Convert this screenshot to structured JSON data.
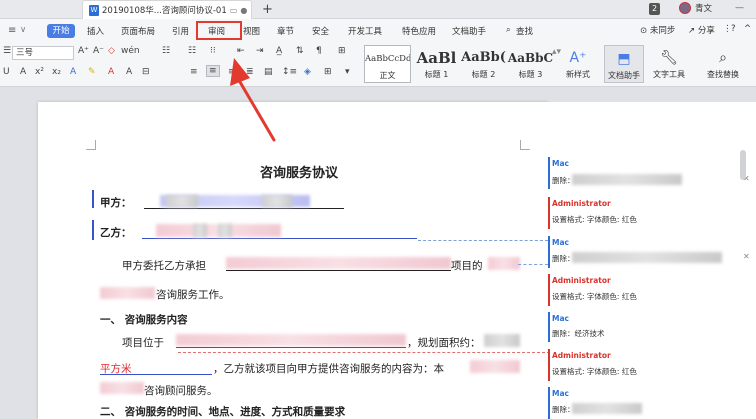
{
  "titlebar": {
    "doc_tab_title": "20190108华...咨询顾问协议-01",
    "new_tab": "+",
    "badge": "2",
    "user_name": "青文",
    "window_controls": "—"
  },
  "ribbon": {
    "menu_icon": "≡",
    "tabs": [
      "开始",
      "插入",
      "页面布局",
      "引用",
      "审阅",
      "视图",
      "章节",
      "安全",
      "开发工具",
      "特色应用",
      "文档助手",
      "查找"
    ],
    "right": {
      "unsynced": "未同步",
      "share": "分享",
      "more": "⋮",
      "help": "?",
      "collapse": "^"
    }
  },
  "toolbar": {
    "font_size": "三号",
    "styles": [
      {
        "preview": "AaBbCcDd",
        "label": "正文"
      },
      {
        "preview": "AaBl",
        "label": "标题 1"
      },
      {
        "preview": "AaBb(",
        "label": "标题 2"
      },
      {
        "preview": "AaBbC",
        "label": "标题 3"
      }
    ],
    "new_style": "新样式",
    "doc_assistant": "文档助手",
    "text_tools": "文字工具",
    "find_replace": "查找替换"
  },
  "document": {
    "title": "咨询服务协议",
    "party_a": "甲方：",
    "party_b": "乙方：",
    "para1_a": "甲方委托乙方承担",
    "para1_b": "项目的",
    "para1_c": "咨询服务工作。",
    "section1": "一、 咨询服务内容",
    "para2_a": "项目位于",
    "para2_b": "，规划面积约：",
    "para3_red": "平方米",
    "para3_b": "，乙方就该项目向甲方提供咨询服务的内容为：本",
    "para4_b": "咨询顾问服务。",
    "section2": "二、 咨询服务的时间、地点、进度、方式和质量要求"
  },
  "comments": [
    {
      "author": "Mac",
      "body": "删除：",
      "color": "#2b6fd6"
    },
    {
      "author": "Administrator",
      "body": "设置格式: 字体颜色: 红色",
      "color": "#d9332c"
    },
    {
      "author": "Mac",
      "body": "删除：",
      "color": "#2b6fd6"
    },
    {
      "author": "Administrator",
      "body": "设置格式: 字体颜色: 红色",
      "color": "#d9332c"
    },
    {
      "author": "Mac",
      "body": "删除：经济技术",
      "color": "#2b6fd6"
    },
    {
      "author": "Administrator",
      "body": "设置格式: 字体颜色: 红色",
      "color": "#d9332c"
    },
    {
      "author": "Mac",
      "body": "删除：",
      "color": "#2b6fd6"
    }
  ]
}
